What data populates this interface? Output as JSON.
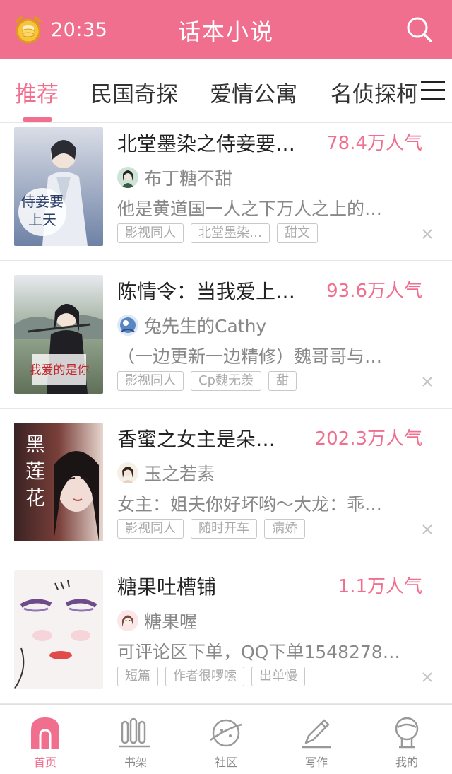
{
  "colors": {
    "brand": "#f06f8f",
    "text": "#222222",
    "muted": "#888888"
  },
  "status": {
    "time": "20:35"
  },
  "header": {
    "title": "话本小说",
    "search_icon": "search-icon",
    "left_icon": "alarm-coin-icon"
  },
  "tabs": [
    "推荐",
    "民国奇探",
    "爱情公寓",
    "名侦探柯"
  ],
  "books": [
    {
      "title": "北堂墨染之侍妾要…",
      "popularity": "78.4万人气",
      "author": "布丁糖不甜",
      "description": "他是黄道国一人之下万人之上的…",
      "tags": [
        "影视同人",
        "北堂墨染…",
        "甜文"
      ],
      "cover_text": "侍妾要上天"
    },
    {
      "title": "陈情令：当我爱上…",
      "popularity": "93.6万人气",
      "author": "兔先生的Cathy",
      "description": "（一边更新一边精修）魏哥哥与…",
      "tags": [
        "影视同人",
        "Cp魏无羡",
        "甜"
      ],
      "cover_text": "我爱的是你"
    },
    {
      "title": "香蜜之女主是朵…",
      "popularity": "202.3万人气",
      "author": "玉之若素",
      "description": "女主：姐夫你好坏哟～大龙：乖…",
      "tags": [
        "影视同人",
        "随时开车",
        "病娇"
      ],
      "cover_text": "黑莲花"
    },
    {
      "title": "糖果吐槽铺",
      "popularity": "1.1万人气",
      "author": "糖果喔",
      "description": "可评论区下单，QQ下单1548278…",
      "tags": [
        "短篇",
        "作者很啰嗦",
        "出单慢"
      ]
    }
  ],
  "bottom_nav": [
    {
      "label": "首页",
      "icon": "home-icon"
    },
    {
      "label": "书架",
      "icon": "bookshelf-icon"
    },
    {
      "label": "社区",
      "icon": "planet-icon"
    },
    {
      "label": "写作",
      "icon": "pencil-icon"
    },
    {
      "label": "我的",
      "icon": "profile-icon"
    }
  ]
}
